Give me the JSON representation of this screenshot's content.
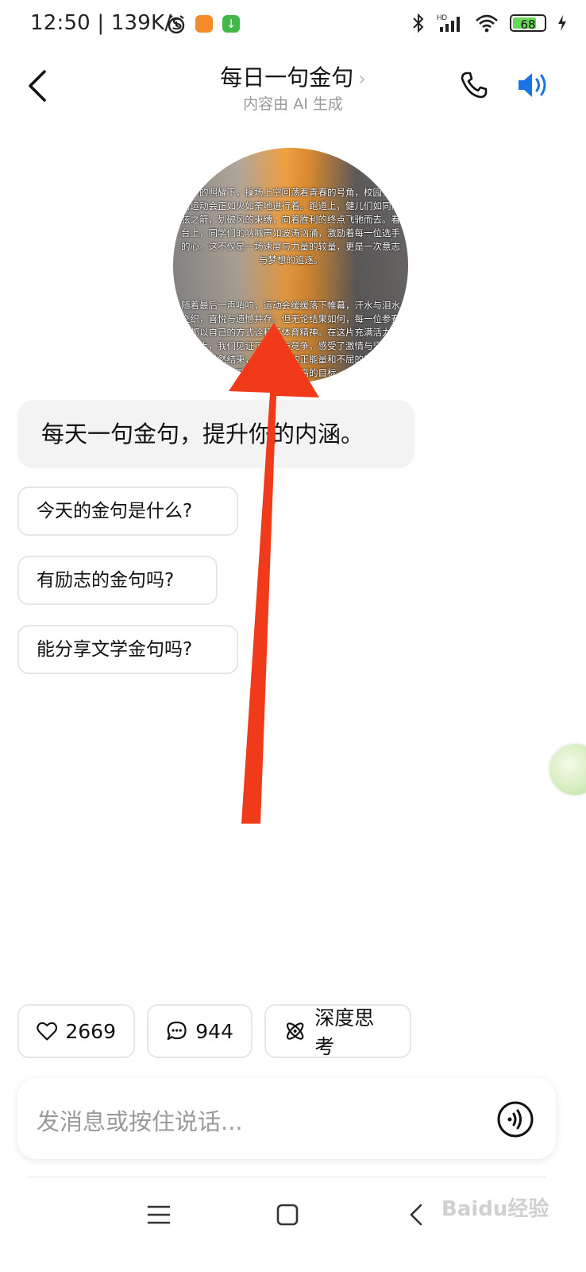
{
  "status_bar": {
    "time": "12:50 | 139K/s",
    "battery": "68",
    "icons": [
      "alarm-icon",
      "app-icon",
      "download-icon",
      "bluetooth-icon",
      "signal-icon",
      "wifi-icon",
      "battery-icon",
      "charging-icon"
    ]
  },
  "header": {
    "title": "每日一句金句",
    "title_chevron": "›",
    "subtitle": "内容由 AI 生成"
  },
  "avatar": {
    "text_block_1": "阳光的照耀下，操场上空回荡着青春的号角，校园空前的运动会正如火如荼地进行着。跑道上，健儿们如同离弦之箭，划破风的束缚，向着胜利的终点飞驰而去。看台上，同学们的呐喊声如波涛汹涌，激励着每一位选手的心。这不仅是一场速度与力量的较量，更是一次意志与梦想的追逐。",
    "text_block_2": "随着最后一声哨响，运动会缓缓落下帷幕，汗水与泪水交织，喜悦与遗憾并存。但无论结果如何，每一位参赛者都以自己的方式诠释了体育精神。在这片充满活力的操场上，我们见证了友谊与竞争，感受了激情与坚持。运动会虽然结束，但它传递的正能量和不屈的精神将激励着我们追求更高的目标。"
  },
  "message": {
    "text": "每天一句金句，提升你的内涵。"
  },
  "suggestions": [
    "今天的金句是什么?",
    "有励志的金句吗?",
    "能分享文学金句吗?"
  ],
  "actions": {
    "likes": "2669",
    "comments": "944",
    "deep_think": "深度思考"
  },
  "input": {
    "placeholder": "发消息或按住说话..."
  },
  "watermark": "Baidu经验",
  "colors": {
    "accent_blue": "#1a73e8",
    "arrow_red": "#f13a1a",
    "bubble_bg": "#f3f3f3"
  }
}
